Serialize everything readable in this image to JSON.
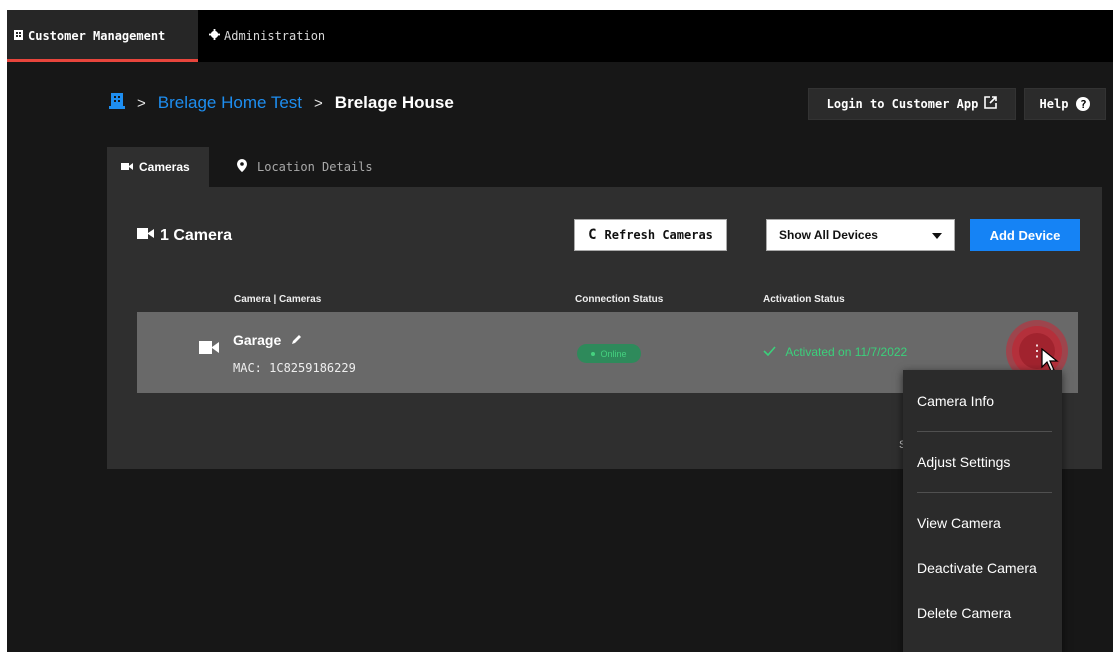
{
  "topnav": {
    "tabs": [
      {
        "label": "Customer Management",
        "icon": "building-icon",
        "active": true
      },
      {
        "label": "Administration",
        "icon": "gear-icon",
        "active": false
      }
    ],
    "accent": "#e8453c"
  },
  "breadcrumb": {
    "home_icon": "building-icon",
    "items": [
      "Brelage Home Test",
      "Brelage House"
    ],
    "separator": ">"
  },
  "header_buttons": {
    "login": "Login to Customer App",
    "login_icon": "external-link-icon",
    "help": "Help",
    "help_icon": "question-icon"
  },
  "subtabs": [
    {
      "label": "Cameras",
      "icon": "camera-icon",
      "active": true
    },
    {
      "label": "Location Details",
      "icon": "location-pin-icon",
      "active": false
    }
  ],
  "panel": {
    "count_label": "1 Camera",
    "refresh_label": "Refresh Cameras",
    "filter_value": "Show All Devices",
    "add_label": "Add Device",
    "columns": [
      "Camera | Cameras",
      "Connection Status",
      "Activation Status"
    ],
    "footer_char": "S",
    "rows": [
      {
        "name": "Garage",
        "mac": "MAC: 1C8259186229",
        "connection": "Online",
        "activation": "Activated on 11/7/2022"
      }
    ]
  },
  "menu": {
    "items": [
      "Camera Info",
      "Adjust Settings",
      "View Camera",
      "Deactivate Camera",
      "Delete Camera"
    ]
  },
  "colors": {
    "link": "#1e8ef0",
    "primary_button": "#1583f5",
    "online": "#45d17f",
    "highlight_ring": "#b4303b"
  }
}
